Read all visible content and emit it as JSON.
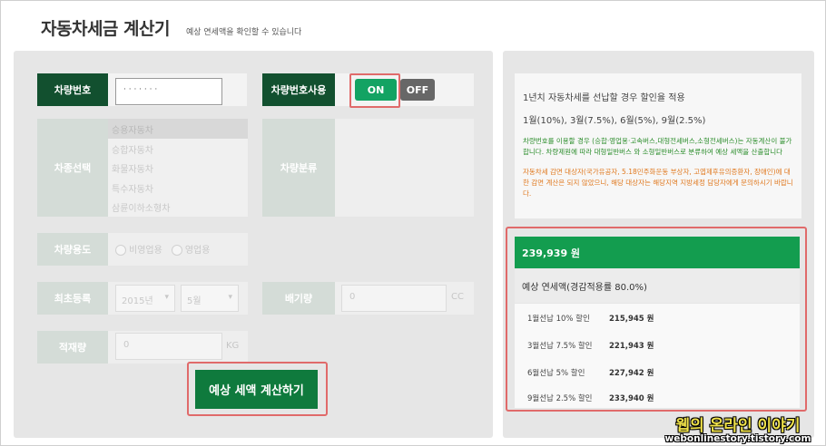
{
  "header": {
    "title": "자동차세금 계산기",
    "subtitle": "예상 연세액을 확인할 수 있습니다"
  },
  "form": {
    "plate_label": "차량번호",
    "plate_value": "· · ‧ ‧ ‧ ‧ ‧",
    "use_plate_label": "차량번호사용",
    "toggle_on": "ON",
    "toggle_off": "OFF",
    "vehicle_type_label": "차종선택",
    "vehicle_types": [
      "승용자동차",
      "승합자동차",
      "화물자동차",
      "특수자동차",
      "삼륜이하소형차"
    ],
    "vehicle_class_label": "차량분류",
    "usage_label": "차량용도",
    "usage_options": [
      "비영업용",
      "영업용"
    ],
    "first_reg_label": "최초등록",
    "reg_year": "2015년",
    "reg_month": "5월",
    "displacement_label": "배기량",
    "displacement_value": "0",
    "displacement_unit": "CC",
    "load_label": "적재량",
    "load_value": "0",
    "load_unit": "KG",
    "calc_button": "예상 세액 계산하기"
  },
  "info": {
    "line1": "1년치 자동차세를 선납할 경우 할인율 적용",
    "line2": "1월(10%), 3월(7.5%), 6월(5%), 9월(2.5%)",
    "green_note": "차량번호를 이용할 경우 (승합·영업용·고속버스,대형전세버스,소형전세버스)는 자동계산이 불가합니다. 차량제원에 따라 대형일반버스 와 소형일반버스로 분류하여 예상 세액을 산출합니다",
    "orange_note": "자동차세 감면 대상자(국가유공자, 5.18민주화운동 부상자, 고엽제후유의증환자, 장애인)에 대한 감면 계산은 되지 않았으니, 해당 대상자는 해당지역 지방세정 담당자에게 문의하시기 바랍니다."
  },
  "result": {
    "total": "239,939 원",
    "sub": "예상 연세액(경감적용률 80.0%)",
    "discounts": [
      {
        "label": "1월선납 10% 할인",
        "amount": "215,945 원"
      },
      {
        "label": "3월선납 7.5% 할인",
        "amount": "221,943 원"
      },
      {
        "label": "6월선납 5% 할인",
        "amount": "227,942 원"
      },
      {
        "label": "9월선납 2.5% 할인",
        "amount": "233,940 원"
      }
    ]
  },
  "watermark": {
    "line1": "웹의 온라인 이야기",
    "line2": "webonlinestory.tistory.com"
  },
  "colors": {
    "dark_green": "#12502f",
    "green": "#139d4f",
    "highlight": "#e06a6a"
  }
}
